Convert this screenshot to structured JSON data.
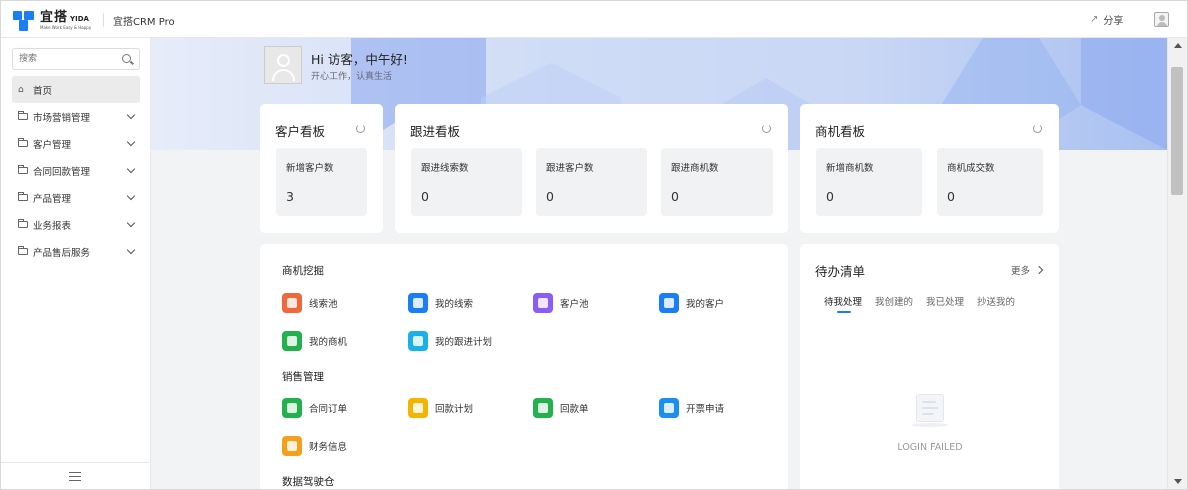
{
  "header": {
    "logo_main": "宜搭",
    "logo_badge": "YIDA",
    "logo_slogan": "Make Work Easy & Happy",
    "app_title": "宜搭CRM Pro",
    "share_label": "分享"
  },
  "sidebar": {
    "search_placeholder": "搜索",
    "items": [
      {
        "label": "首页",
        "active": true
      },
      {
        "label": "市场营销管理"
      },
      {
        "label": "客户管理"
      },
      {
        "label": "合同回款管理"
      },
      {
        "label": "产品管理"
      },
      {
        "label": "业务报表"
      },
      {
        "label": "产品售后服务"
      }
    ]
  },
  "greeting": {
    "title": "Hi 访客，中午好!",
    "subtitle": "开心工作，认真生活"
  },
  "customer_board": {
    "title": "客户看板",
    "tiles": [
      {
        "label": "新增客户数",
        "value": "3"
      }
    ]
  },
  "followup_board": {
    "title": "跟进看板",
    "tiles": [
      {
        "label": "跟进线索数",
        "value": "0"
      },
      {
        "label": "跟进客户数",
        "value": "0"
      },
      {
        "label": "跟进商机数",
        "value": "0"
      }
    ]
  },
  "opportunity_board": {
    "title": "商机看板",
    "tiles": [
      {
        "label": "新增商机数",
        "value": "0"
      },
      {
        "label": "商机成交数",
        "value": "0"
      }
    ]
  },
  "apps": {
    "sections": [
      {
        "title": "商机挖掘",
        "items": [
          {
            "label": "线索池",
            "color": "#f0683a"
          },
          {
            "label": "我的线索",
            "color": "#1a7ef5"
          },
          {
            "label": "客户池",
            "color": "#8b5cf6"
          },
          {
            "label": "我的客户",
            "color": "#1a7ef5"
          },
          {
            "label": "我的商机",
            "color": "#22b14c"
          },
          {
            "label": "我的跟进计划",
            "color": "#1ab0e8"
          }
        ]
      },
      {
        "title": "销售管理",
        "items": [
          {
            "label": "合同订单",
            "color": "#22b14c"
          },
          {
            "label": "回款计划",
            "color": "#f5b400"
          },
          {
            "label": "回款单",
            "color": "#22b14c"
          },
          {
            "label": "开票申请",
            "color": "#1a8ff0"
          },
          {
            "label": "财务信息",
            "color": "#f5a01a"
          }
        ]
      },
      {
        "title": "数据驾驶仓"
      }
    ]
  },
  "todo": {
    "title": "待办清单",
    "more_label": "更多",
    "tabs": [
      "待我处理",
      "我创建的",
      "我已处理",
      "抄送我的"
    ],
    "empty_text": "LOGIN FAILED"
  }
}
